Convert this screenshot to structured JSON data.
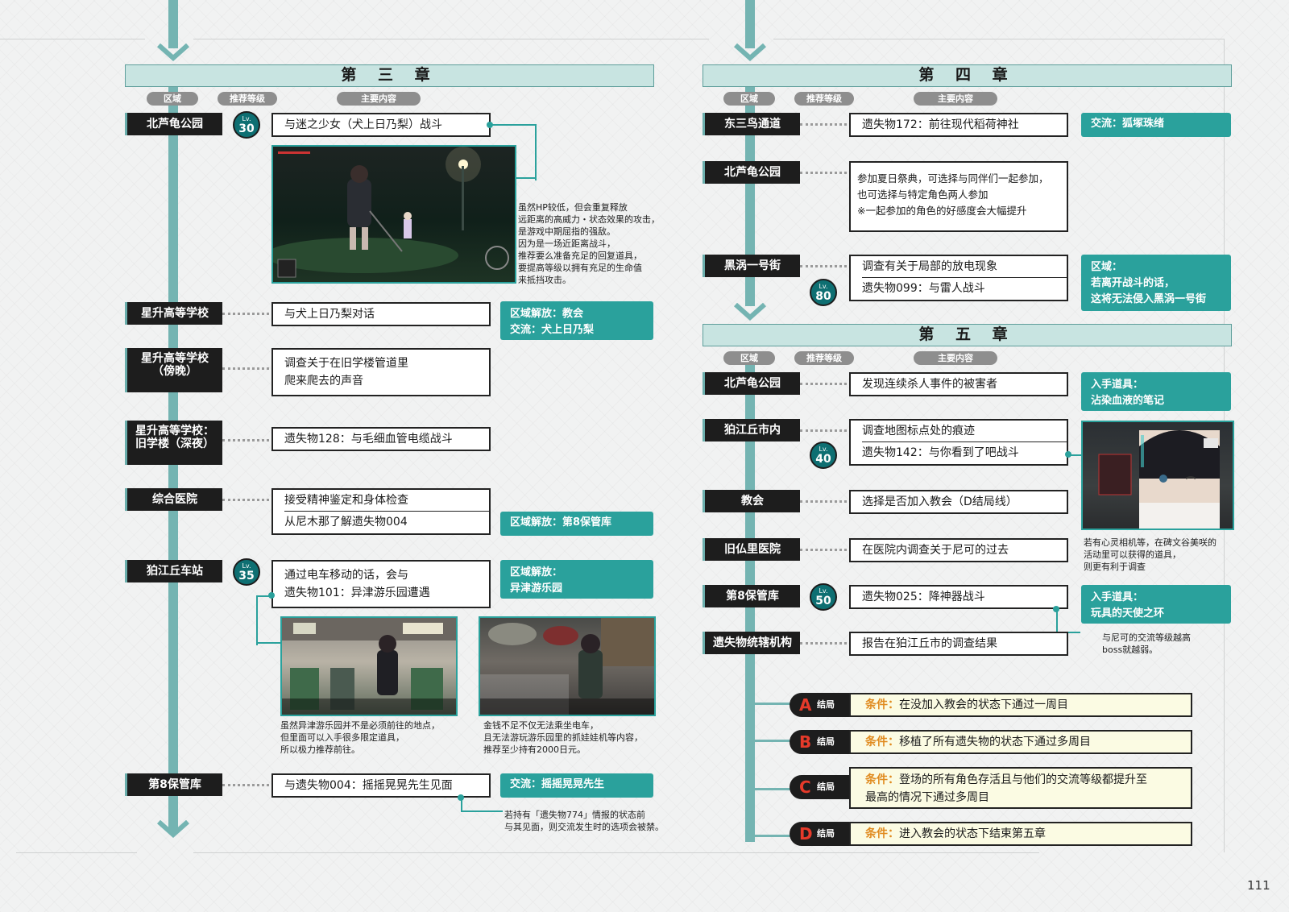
{
  "page_number": "111",
  "left": {
    "chapter_title": "第 三 章",
    "headers": {
      "region": "区域",
      "level": "推荐等级",
      "content": "主要内容"
    },
    "rows": [
      {
        "region": "北芦龟公园",
        "level_label": "Lv.",
        "level": "30",
        "content": [
          "与迷之少女（犬上日乃梨）战斗"
        ]
      },
      {
        "region": "星升高等学校",
        "content": [
          "与犬上日乃梨对话"
        ],
        "tag": [
          "区域解放：教会",
          "交流：犬上日乃梨"
        ]
      },
      {
        "region": "星升高等学校\n（傍晚）",
        "content": [
          "调查关于在旧学楼管道里\n爬来爬去的声音"
        ]
      },
      {
        "region": "星升高等学校：\n旧学楼（深夜）",
        "content": [
          "遗失物128：与毛细血管电缆战斗"
        ]
      },
      {
        "region": "综合医院",
        "content": [
          "接受精神鉴定和身体检查",
          "从尼木那了解遗失物004"
        ],
        "tag": [
          "区域解放：第8保管库"
        ]
      },
      {
        "region": "狛江丘车站",
        "level_label": "Lv.",
        "level": "35",
        "content": [
          "通过电车移动的话，会与\n遗失物101：异津游乐园遭遇"
        ],
        "tag": [
          "区域解放：",
          "异津游乐园"
        ]
      },
      {
        "region": "第8保管库",
        "content": [
          "与遗失物004：摇摇晃晃先生见面"
        ],
        "tag": [
          "交流：摇摇晃晃先生"
        ]
      }
    ],
    "notes": {
      "battle": "虽然HP较低，但会重复释放\n远距离的高威力・状态效果的攻击，\n是游戏中期屈指的强敌。\n因为是一场近距离战斗，\n推荐要么准备充足的回复道具，\n要提高等级以拥有充足的生命值\n来抵挡攻击。",
      "station": "虽然异津游乐园并不是必须前往的地点，\n但里面可以入手很多限定道具，\n所以极力推荐前往。",
      "park": "金钱不足不仅无法乘坐电车，\n且无法游玩游乐园里的抓娃娃机等内容，\n推荐至少持有2000日元。",
      "vault": "若持有「遗失物774」情报的状态前\n与其见面，则交流发生时的选项会被禁。"
    }
  },
  "right": {
    "chapter4_title": "第 四 章",
    "chapter5_title": "第 五 章",
    "headers": {
      "region": "区域",
      "level": "推荐等级",
      "content": "主要内容"
    },
    "ch4_rows": [
      {
        "region": "东三鸟通道",
        "content": [
          "遗失物172：前往现代稻荷神社"
        ],
        "tag": [
          "交流：狐塚珠绪"
        ]
      },
      {
        "region": "北芦龟公园",
        "content": [
          "参加夏日祭典，可选择与同伴们一起参加，\n也可选择与特定角色两人参加\n※一起参加的角色的好感度会大幅提升"
        ]
      },
      {
        "region": "黑涡一号街",
        "level_label": "Lv.",
        "level": "80",
        "content": [
          "调查有关于局部的放电现象",
          "遗失物099：与雷人战斗"
        ],
        "tag": [
          "区域：",
          "若离开战斗的话，",
          "这将无法侵入黑涡一号街"
        ]
      }
    ],
    "ch5_rows": [
      {
        "region": "北芦龟公园",
        "content": [
          "发现连续杀人事件的被害者"
        ],
        "tag": [
          "入手道具：",
          "沾染血液的笔记"
        ]
      },
      {
        "region": "狛江丘市内",
        "level_label": "Lv.",
        "level": "40",
        "content": [
          "调查地图标点处的痕迹",
          "遗失物142：与你看到了吧战斗"
        ]
      },
      {
        "region": "教会",
        "content": [
          "选择是否加入教会（D结局线）"
        ]
      },
      {
        "region": "旧仏里医院",
        "content": [
          "在医院内调查关于尼可的过去"
        ]
      },
      {
        "region": "第8保管库",
        "level_label": "Lv.",
        "level": "50",
        "content": [
          "遗失物025：降神器战斗"
        ],
        "tag": [
          "入手道具：",
          "玩具的天使之环"
        ]
      },
      {
        "region": "遗失物统辖机构",
        "content": [
          "报告在狛江丘市的调查结果"
        ]
      }
    ],
    "notes": {
      "spirit": "若有心灵相机等，在碑文谷美咲的\n活动里可以获得的道具，\n则更有利于调查",
      "boss": "与尼可的交流等级越高\nboss就越弱。"
    },
    "endings": [
      {
        "letter": "A",
        "word": "结局",
        "cond_label": "条件：",
        "text": "在没加入教会的状态下通过一周目"
      },
      {
        "letter": "B",
        "word": "结局",
        "cond_label": "条件：",
        "text": "移植了所有遗失物的状态下通过多周目"
      },
      {
        "letter": "C",
        "word": "结局",
        "cond_label": "条件：",
        "text": "登场的所有角色存活且与他们的交流等级都提升至\n最高的情况下通过多周目"
      },
      {
        "letter": "D",
        "word": "结局",
        "cond_label": "条件：",
        "text": "进入教会的状态下结束第五章"
      }
    ]
  },
  "colors": {
    "teal": "#2aa19c",
    "teal_light": "#74b4b2",
    "bar": "#c8e4e1",
    "condition": "#e08a1e",
    "ending_letter": "#e63a2a"
  }
}
